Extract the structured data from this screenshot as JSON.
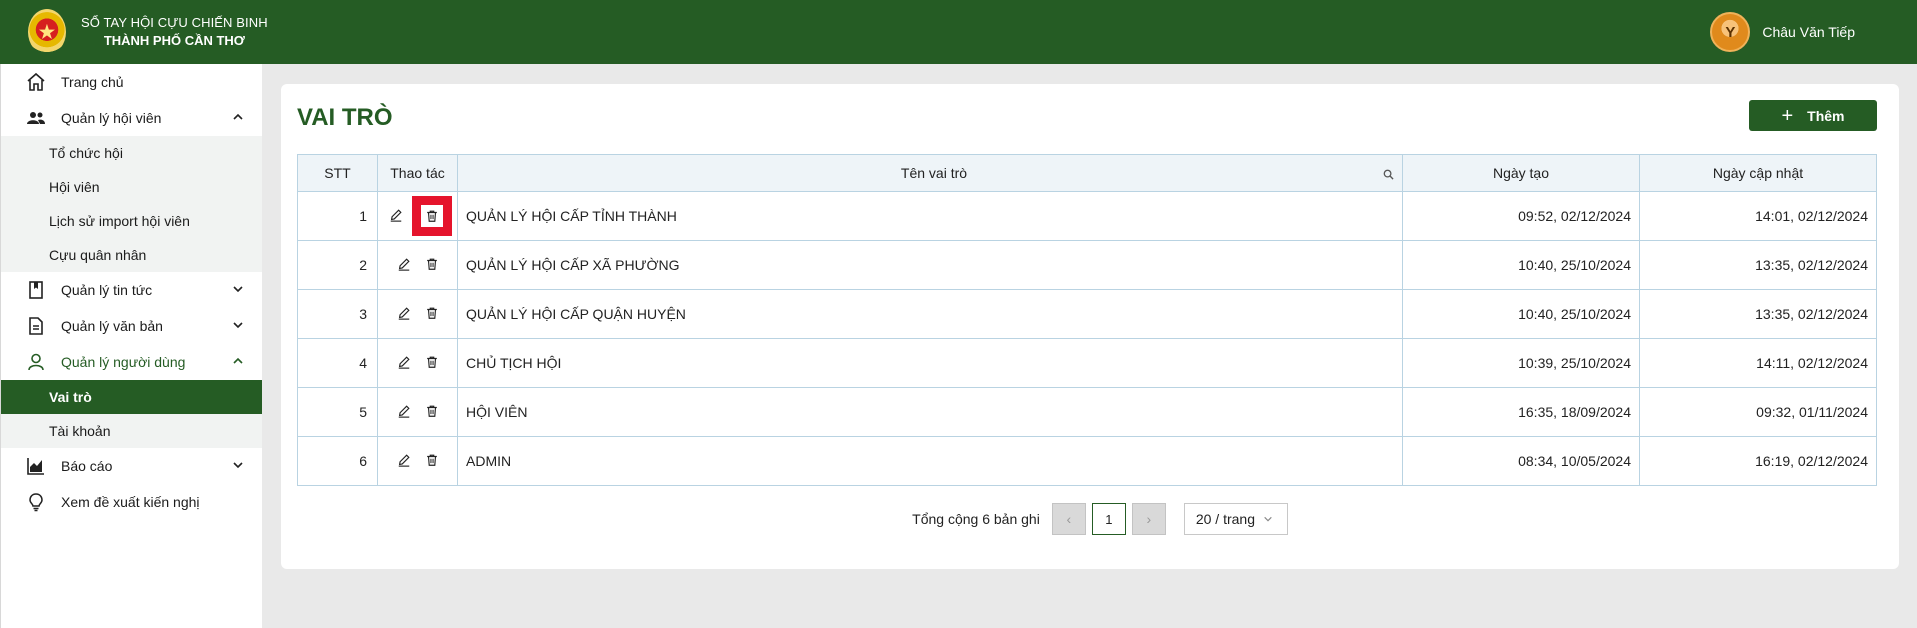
{
  "header": {
    "org_line1": "SỔ TAY HỘI CỰU CHIẾN BINH",
    "org_line2": "THÀNH PHỐ CẦN THƠ",
    "user_name": "Châu Văn Tiếp",
    "brand_color": "#255c24"
  },
  "sidebar": {
    "items": [
      {
        "label": "Trang chủ",
        "icon": "home-icon"
      },
      {
        "label": "Quản lý hội viên",
        "icon": "users-icon",
        "expanded": true,
        "children": [
          "Tổ chức hội",
          "Hội viên",
          "Lịch sử import hội viên",
          "Cựu quân nhân"
        ]
      },
      {
        "label": "Quản lý tin tức",
        "icon": "bookmark-icon",
        "expanded": false
      },
      {
        "label": "Quản lý văn bản",
        "icon": "document-icon",
        "expanded": false
      },
      {
        "label": "Quản lý người dùng",
        "icon": "user-icon",
        "expanded": true,
        "children": [
          "Vai trò",
          "Tài khoản"
        ],
        "selected_child": "Vai trò"
      },
      {
        "label": "Báo cáo",
        "icon": "chart-icon",
        "expanded": false
      },
      {
        "label": "Xem đề xuất kiến nghị",
        "icon": "lightbulb-icon"
      }
    ]
  },
  "main": {
    "title": "VAI TRÒ",
    "add_label": "Thêm",
    "columns": {
      "stt": "STT",
      "actions": "Thao tác",
      "name": "Tên vai trò",
      "created": "Ngày tạo",
      "updated": "Ngày cập nhật"
    },
    "rows": [
      {
        "stt": "1",
        "name": "QUẢN LÝ HỘI CẤP TỈNH THÀNH",
        "created": "09:52, 02/12/2024",
        "updated": "14:01, 02/12/2024"
      },
      {
        "stt": "2",
        "name": "QUẢN LÝ HỘI CẤP XÃ PHƯỜNG",
        "created": "10:40, 25/10/2024",
        "updated": "13:35, 02/12/2024"
      },
      {
        "stt": "3",
        "name": "QUẢN LÝ HỘI CẤP QUẬN HUYỆN",
        "created": "10:40, 25/10/2024",
        "updated": "13:35, 02/12/2024"
      },
      {
        "stt": "4",
        "name": "CHỦ TỊCH HỘI",
        "created": "10:39, 25/10/2024",
        "updated": "14:11, 02/12/2024"
      },
      {
        "stt": "5",
        "name": "HỘI VIÊN",
        "created": "16:35, 18/09/2024",
        "updated": "09:32, 01/11/2024"
      },
      {
        "stt": "6",
        "name": "ADMIN",
        "created": "08:34, 10/05/2024",
        "updated": "16:19, 02/12/2024"
      }
    ],
    "pagination": {
      "total_text": "Tổng cộng 6 bản ghi",
      "current_page": "1",
      "page_size": "20 / trang"
    }
  }
}
